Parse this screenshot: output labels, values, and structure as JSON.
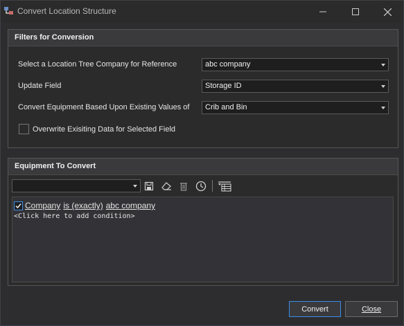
{
  "window": {
    "title": "Convert Location Structure",
    "controls": [
      "minimize-icon",
      "maximize-icon",
      "close-icon"
    ]
  },
  "filters_group": {
    "header": "Filters for Conversion",
    "rows": [
      {
        "label": "Select a Location Tree Company for Reference",
        "value": "abc company"
      },
      {
        "label": "Update Field",
        "value": "Storage ID"
      },
      {
        "label": "Convert Equipment Based Upon Existing Values of",
        "value": "Crib and Bin"
      }
    ],
    "overwrite_label": "Overwrite Exisiting Data for Selected Field",
    "overwrite_checked": false
  },
  "equipment_group": {
    "header": "Equipment To Convert",
    "toolbar": {
      "filter_combo_value": "",
      "icons": [
        "save-icon",
        "eraser-icon",
        "trash-icon",
        "history-icon",
        "filter-edit-icon"
      ]
    },
    "condition": {
      "checked": true,
      "field": "Company",
      "operator": "is (exactly)",
      "value": "abc company"
    },
    "add_condition": "<Click here to add condition>"
  },
  "buttons": {
    "convert": "Convert",
    "close": "Close"
  },
  "colors": {
    "background": "#2b2b2b",
    "accent": "#3c8ee8",
    "header": "#3a3a3d"
  }
}
